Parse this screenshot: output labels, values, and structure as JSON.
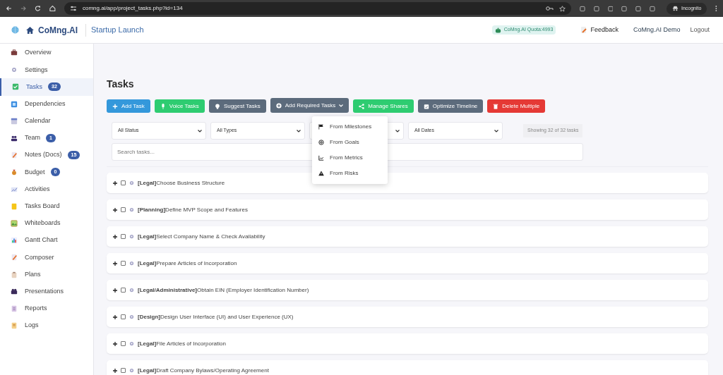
{
  "browser": {
    "url": "comng.ai/app/project_tasks.php?id=134",
    "profile": "Incognito"
  },
  "header": {
    "brand": "CoMng.AI",
    "project": "Startup Launch",
    "quota": "CoMng.AI Quota:4993",
    "feedback": "Feedback",
    "user": "CoMng.AI Demo",
    "logout": "Logout"
  },
  "sidebar": {
    "items": [
      {
        "label": "Overview",
        "selected": false
      },
      {
        "label": "Settings",
        "selected": false
      },
      {
        "label": "Tasks",
        "badge": "32",
        "selected": true
      },
      {
        "label": "Dependencies",
        "selected": false
      },
      {
        "label": "Calendar",
        "selected": false
      },
      {
        "label": "Team",
        "badge": "1",
        "selected": false
      },
      {
        "label": "Notes (Docs)",
        "badge": "15",
        "selected": false
      },
      {
        "label": "Budget",
        "badge": "0",
        "selected": false
      },
      {
        "label": "Activities",
        "selected": false
      },
      {
        "label": "Tasks Board",
        "selected": false
      },
      {
        "label": "Whiteboards",
        "selected": false
      },
      {
        "label": "Gantt Chart",
        "selected": false
      },
      {
        "label": "Composer",
        "selected": false
      },
      {
        "label": "Plans",
        "selected": false
      },
      {
        "label": "Presentations",
        "selected": false
      },
      {
        "label": "Reports",
        "selected": false
      },
      {
        "label": "Logs",
        "selected": false
      }
    ]
  },
  "page_title": "Tasks",
  "toolbar": [
    {
      "label": "Add Task",
      "kind": "plus",
      "color": "#3498db"
    },
    {
      "label": "Voice Tasks",
      "kind": "mic",
      "color": "#2ecc71"
    },
    {
      "label": "Suggest Tasks",
      "kind": "bulb",
      "color": "#5c6b7c"
    },
    {
      "label": "Add Required Tasks",
      "kind": "dropdown",
      "color": "#5c6b7c",
      "expanded": true
    },
    {
      "label": "Manage Shares",
      "kind": "share",
      "color": "#2ecc71"
    },
    {
      "label": "Optimize Timeline",
      "kind": "calendar",
      "color": "#5c6b7c"
    },
    {
      "label": "Delete Multiple",
      "kind": "trash",
      "color": "#e53935"
    }
  ],
  "menu": [
    {
      "label": "From Milestones",
      "kind": "flag"
    },
    {
      "label": "From Goals",
      "kind": "target"
    },
    {
      "label": "From Metrics",
      "kind": "chart"
    },
    {
      "label": "From Risks",
      "kind": "warning"
    }
  ],
  "filters": [
    {
      "kind": "select",
      "value": "All Status"
    },
    {
      "kind": "select",
      "value": "All Types"
    },
    {
      "kind": "select"
    },
    {
      "kind": "select",
      "value": "All Dates"
    }
  ],
  "count": "Showing 32 of 32 tasks",
  "search": {
    "placeholder": "Search tasks..."
  },
  "tasks": [
    {
      "text": "**[Legal]**Choose Business Structure",
      "checked": false
    },
    {
      "text": "**[Planning]**Define MVP Scope and Features",
      "checked": false
    },
    {
      "text": "**[Legal]**Select Company Name & Check Availability",
      "checked": false
    },
    {
      "text": "**[Legal]**Prepare Articles of Incorporation",
      "checked": false
    },
    {
      "text": "**[Legal/Administrative]**Obtain EIN (Employer Identification Number)",
      "checked": false
    },
    {
      "text": "**[Design]**Design User Interface (UI) and User Experience (UX)",
      "checked": false
    },
    {
      "text": "**[Legal]**File Articles of Incorporation",
      "checked": false
    },
    {
      "text": "**[Legal]**Draft Company Bylaws/Operating Agreement",
      "checked": false
    }
  ]
}
